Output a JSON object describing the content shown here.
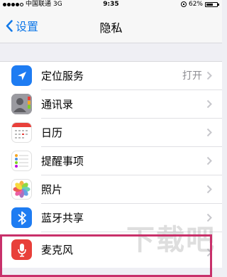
{
  "status": {
    "carrier": "中国联通",
    "network": "3G",
    "time": "9:35",
    "battery": "62%",
    "battery_level": 0.62
  },
  "nav": {
    "back_label": "设置",
    "title": "隐私"
  },
  "rows": [
    {
      "label": "定位服务",
      "value": "打开",
      "icon": "location-arrow-icon",
      "color": "#1e7cf2"
    },
    {
      "label": "通讯录",
      "value": "",
      "icon": "contacts-icon",
      "color": "#8e8e93"
    },
    {
      "label": "日历",
      "value": "",
      "icon": "calendar-icon",
      "color": "#ffffff"
    },
    {
      "label": "提醒事项",
      "value": "",
      "icon": "reminders-icon",
      "color": "#ffffff"
    },
    {
      "label": "照片",
      "value": "",
      "icon": "photos-icon",
      "color": "#ffffff"
    },
    {
      "label": "蓝牙共享",
      "value": "",
      "icon": "bluetooth-icon",
      "color": "#1e7cf2"
    },
    {
      "label": "麦克风",
      "value": "",
      "icon": "microphone-icon",
      "color": "#e8403a"
    }
  ],
  "watermark": "下载吧",
  "accent_color": "#1279e8",
  "highlight_color": "#c8306a"
}
